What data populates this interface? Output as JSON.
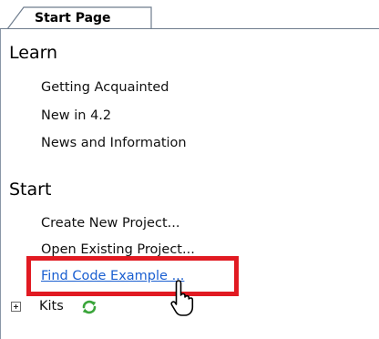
{
  "tab": {
    "label": "Start Page"
  },
  "learn": {
    "heading": "Learn",
    "items": [
      {
        "label": "Getting Acquainted"
      },
      {
        "label": "New in 4.2"
      },
      {
        "label": "News and Information"
      }
    ]
  },
  "start": {
    "heading": "Start",
    "items": [
      {
        "label": "Create New Project..."
      },
      {
        "label": "Open Existing Project..."
      },
      {
        "label": "Find Code Example ..."
      }
    ]
  },
  "kits": {
    "label": "Kits",
    "icon": "refresh-icon"
  },
  "colors": {
    "link": "#1a5fd1",
    "highlight": "#e11a22",
    "refresh": "#3aa53a"
  }
}
